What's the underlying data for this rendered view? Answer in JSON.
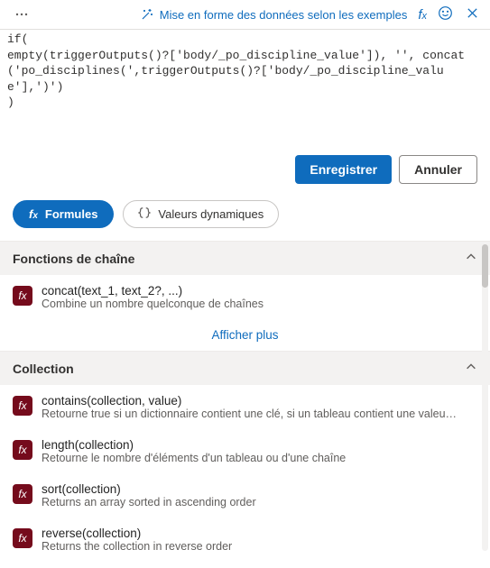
{
  "header": {
    "title": "Mise en forme des données selon les exemples"
  },
  "code": "if(\nempty(triggerOutputs()?['body/_po_discipline_value']), '', concat('po_disciplines(',triggerOutputs()?['body/_po_discipline_value'],')')\n)",
  "buttons": {
    "save": "Enregistrer",
    "cancel": "Annuler"
  },
  "pills": {
    "formulas": "Formules",
    "dynamic": "Valeurs dynamiques"
  },
  "groups": {
    "g1": {
      "title": "Fonctions de chaîne",
      "show_more": "Afficher plus",
      "items": {
        "i0": {
          "name": "concat(text_1, text_2?, ...)",
          "desc": "Combine un nombre quelconque de chaînes"
        }
      }
    },
    "g2": {
      "title": "Collection",
      "items": {
        "i0": {
          "name": "contains(collection, value)",
          "desc": "Retourne true si un dictionnaire contient une clé, si un tableau contient une valeur ou si une chaîne contient une autre chaîne"
        },
        "i1": {
          "name": "length(collection)",
          "desc": "Retourne le nombre d'éléments d'un tableau ou d'une chaîne"
        },
        "i2": {
          "name": "sort(collection)",
          "desc": "Returns an array sorted in ascending order"
        },
        "i3": {
          "name": "reverse(collection)",
          "desc": "Returns the collection in reverse order"
        }
      }
    }
  },
  "icons": {
    "fx_small": "fx"
  }
}
